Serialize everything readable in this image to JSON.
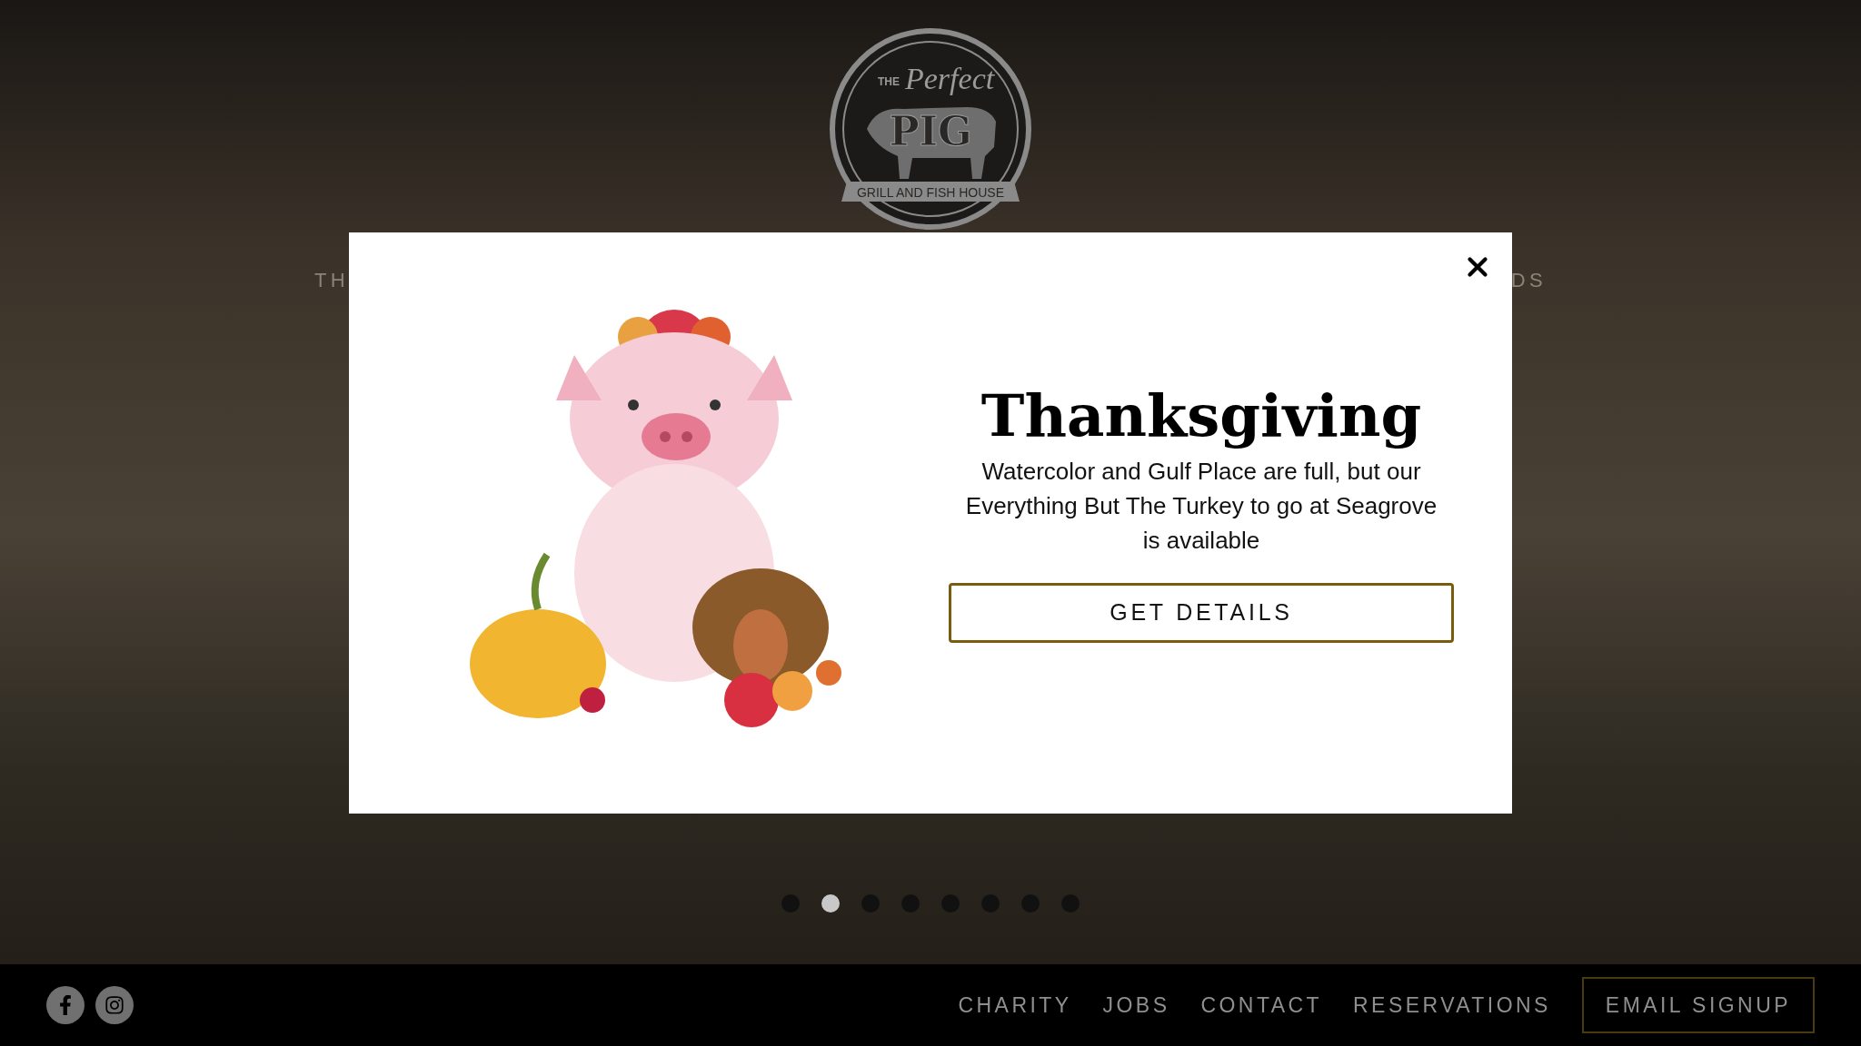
{
  "logo": {
    "top": "THE",
    "script": "Perfect",
    "name": "PIG",
    "banner": "GRILL AND FISH HOUSE"
  },
  "nav": [
    "TH",
    "DS"
  ],
  "carousel": {
    "dots": [
      {
        "selected": false
      },
      {
        "selected": true
      },
      {
        "selected": false
      },
      {
        "selected": false
      },
      {
        "selected": false
      },
      {
        "selected": false
      },
      {
        "selected": false
      },
      {
        "selected": false
      }
    ]
  },
  "modal": {
    "title": "Thanksgiving",
    "text": "Watercolor and Gulf Place are full, but our Everything But The Turkey to go at Seagrove is available",
    "button": "GET DETAILS"
  },
  "footer": {
    "social": [
      {
        "kind": "facebook"
      },
      {
        "kind": "instagram"
      }
    ],
    "links": [
      "CHARITY",
      "JOBS",
      "CONTACT",
      "RESERVATIONS"
    ],
    "signup": "EMAIL SIGNUP"
  }
}
